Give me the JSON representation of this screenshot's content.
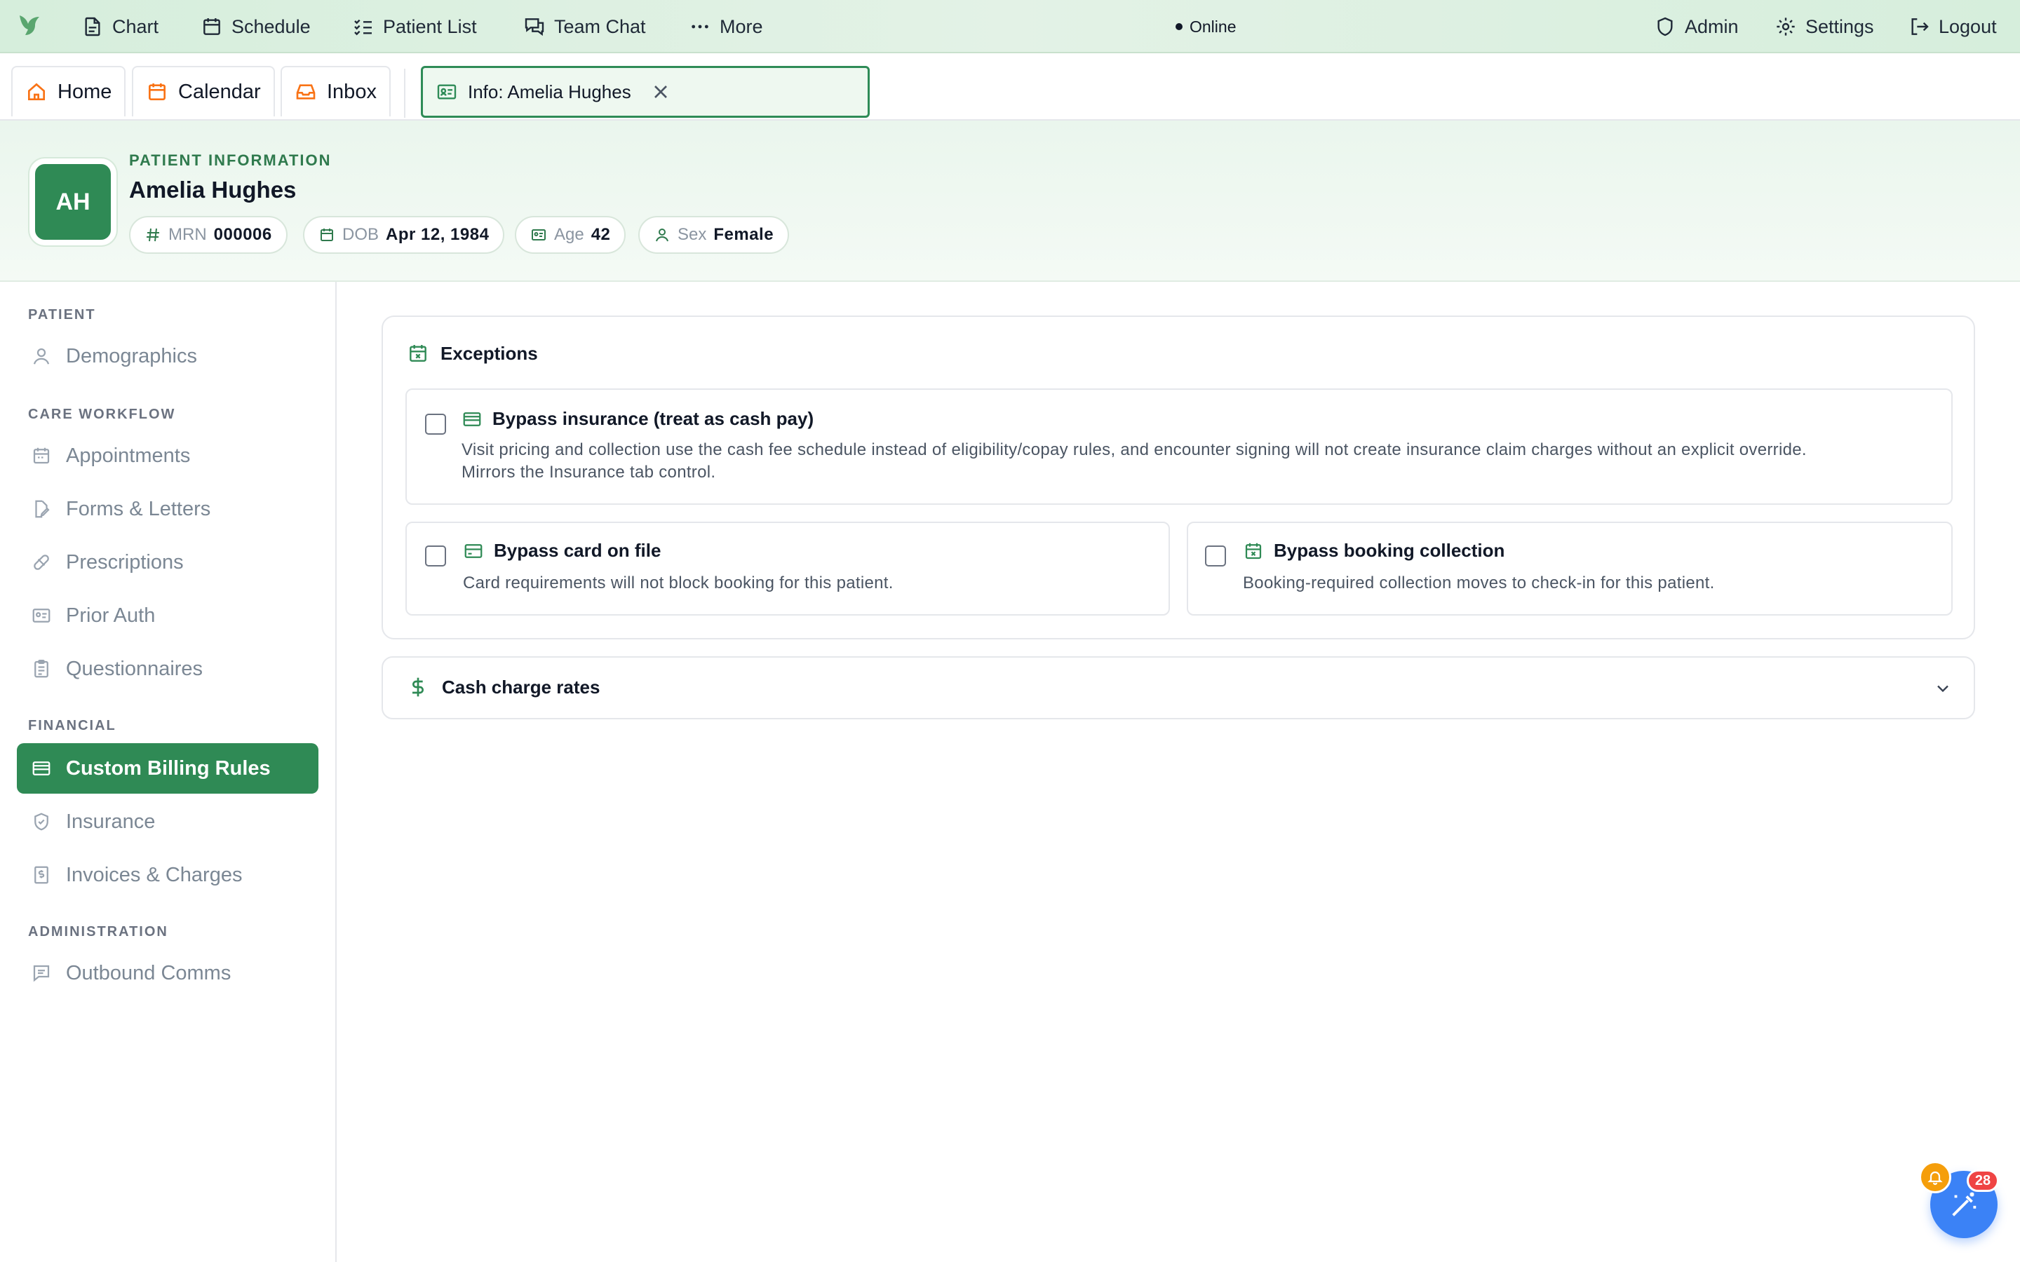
{
  "topnav": {
    "logo_icon": "bird-logo-icon",
    "items": [
      {
        "label": "Chart",
        "icon": "document-icon"
      },
      {
        "label": "Schedule",
        "icon": "calendar-icon"
      },
      {
        "label": "Patient List",
        "icon": "list-check-icon"
      },
      {
        "label": "Team Chat",
        "icon": "chat-icon"
      },
      {
        "label": "More",
        "icon": "ellipsis-icon"
      }
    ],
    "status": "Online",
    "right_items": [
      {
        "label": "Admin",
        "icon": "shield-icon"
      },
      {
        "label": "Settings",
        "icon": "gear-icon"
      },
      {
        "label": "Logout",
        "icon": "logout-icon"
      }
    ]
  },
  "tabs": {
    "items": [
      {
        "label": "Home",
        "icon": "home-icon"
      },
      {
        "label": "Calendar",
        "icon": "calendar-icon"
      },
      {
        "label": "Inbox",
        "icon": "inbox-icon"
      }
    ],
    "active": {
      "label": "Info: Amelia Hughes",
      "icon": "id-card-icon"
    }
  },
  "patient": {
    "section_label": "PATIENT INFORMATION",
    "initials": "AH",
    "name": "Amelia Hughes",
    "chips": [
      {
        "key": "MRN",
        "value": "000006",
        "icon": "hash-icon"
      },
      {
        "key": "DOB",
        "value": "Apr 12, 1984",
        "icon": "calendar-icon"
      },
      {
        "key": "Age",
        "value": "42",
        "icon": "id-card-icon"
      },
      {
        "key": "Sex",
        "value": "Female",
        "icon": "user-icon"
      }
    ]
  },
  "sidebar": {
    "sections": [
      {
        "label": "PATIENT",
        "items": [
          {
            "label": "Demographics",
            "icon": "user-icon"
          }
        ]
      },
      {
        "label": "CARE WORKFLOW",
        "items": [
          {
            "label": "Appointments",
            "icon": "calendar-icon"
          },
          {
            "label": "Forms & Letters",
            "icon": "file-edit-icon"
          },
          {
            "label": "Prescriptions",
            "icon": "pill-icon"
          },
          {
            "label": "Prior Auth",
            "icon": "id-card-icon"
          },
          {
            "label": "Questionnaires",
            "icon": "clipboard-icon"
          }
        ]
      },
      {
        "label": "FINANCIAL",
        "items": [
          {
            "label": "Custom Billing Rules",
            "icon": "wallet-icon",
            "active": true
          },
          {
            "label": "Insurance",
            "icon": "shield-check-icon"
          },
          {
            "label": "Invoices & Charges",
            "icon": "receipt-icon"
          }
        ]
      },
      {
        "label": "ADMINISTRATION",
        "items": [
          {
            "label": "Outbound Comms",
            "icon": "message-icon"
          }
        ]
      }
    ]
  },
  "main": {
    "exceptions": {
      "title": "Exceptions",
      "icon": "calendar-x-icon",
      "options": [
        {
          "title": "Bypass insurance (treat as cash pay)",
          "icon": "wallet-icon",
          "description_line1": "Visit pricing and collection use the cash fee schedule instead of eligibility/copay rules, and encounter signing will not create insurance claim charges without an explicit override.",
          "description_line2": "Mirrors the Insurance tab control.",
          "checked": false
        },
        {
          "title": "Bypass card on file",
          "icon": "credit-card-icon",
          "description": "Card requirements will not block booking for this patient.",
          "checked": false
        },
        {
          "title": "Bypass booking collection",
          "icon": "calendar-x-icon",
          "description": "Booking-required collection moves to check-in for this patient.",
          "checked": false
        }
      ]
    },
    "cash_rates": {
      "title": "Cash charge rates",
      "icon": "dollar-icon",
      "expanded": false
    }
  },
  "fab": {
    "icon": "magic-wand-icon",
    "bell_icon": "bell-icon",
    "badge_count": "28"
  },
  "colors": {
    "brand_green": "#2f8a55",
    "nav_bg": "#d6eedc",
    "accent_orange": "#f97316",
    "fab_blue": "#3b82f6",
    "badge_red": "#ef4444"
  }
}
